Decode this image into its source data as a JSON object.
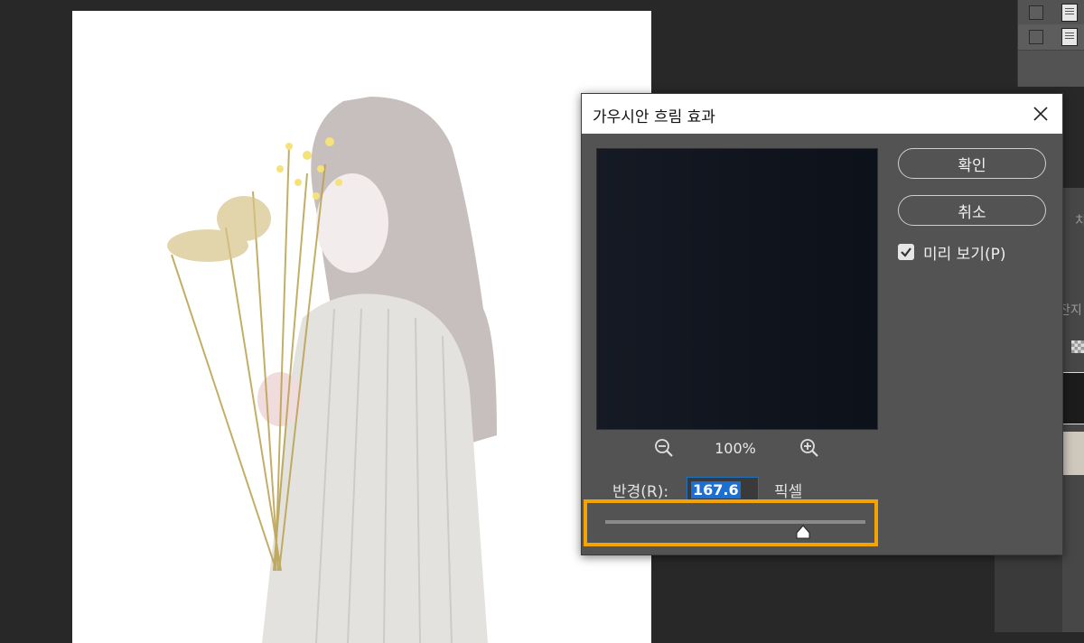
{
  "dialog": {
    "title": "가우시안 흐림 효과",
    "ok_label": "확인",
    "cancel_label": "취소",
    "preview_label": "미리 보기(P)",
    "preview_checked": true,
    "zoom_level": "100%",
    "radius_label": "반경(R):",
    "radius_value": "167.6",
    "radius_unit": "픽셀",
    "slider_fraction": 0.76,
    "highlight_color": "#f5a300"
  },
  "side_panel": {
    "text_1": "치",
    "text_2": "잔지"
  },
  "icons": [
    "close-icon",
    "zoom-out-icon",
    "zoom-in-icon",
    "check-icon",
    "document-icon",
    "checkerboard-icon"
  ]
}
